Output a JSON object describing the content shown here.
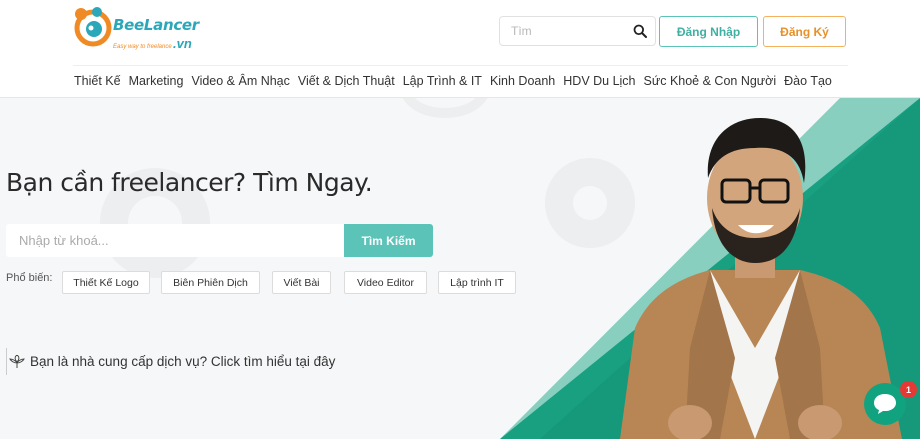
{
  "brand": {
    "name": "BeeLancer",
    "suffix": ".vn",
    "tagline": "Easy way to freelance"
  },
  "header": {
    "search_placeholder": "Tìm",
    "login_label": "Đăng Nhập",
    "signup_label": "Đăng Ký"
  },
  "nav": {
    "items": [
      {
        "label": "Thiết Kế"
      },
      {
        "label": "Marketing"
      },
      {
        "label": "Video & Âm Nhạc"
      },
      {
        "label": "Viết & Dịch Thuật"
      },
      {
        "label": "Lập Trình & IT"
      },
      {
        "label": "Kinh Doanh"
      },
      {
        "label": "HDV Du Lịch"
      },
      {
        "label": "Sức Khoẻ & Con Người"
      },
      {
        "label": "Đào Tạo"
      }
    ]
  },
  "hero": {
    "title": "Bạn cần freelancer? Tìm Ngay.",
    "search_placeholder": "Nhập từ khoá...",
    "search_button": "Tìm Kiếm",
    "popular_label": "Phổ biến:",
    "popular_tags": [
      "Thiết Kế Logo",
      "Biên Phiên Dịch",
      "Viết Bài",
      "Video Editor",
      "Lập trình IT"
    ],
    "provider_cta": "Bạn là nhà cung cấp dịch vụ? Click tìm hiểu tại đây"
  },
  "chat": {
    "badge_count": "1"
  },
  "colors": {
    "accent_teal": "#5cc3b9",
    "accent_orange": "#f4b25e",
    "green_band": "#16987a",
    "chat_green": "#11a37f",
    "badge_red": "#e53935"
  }
}
